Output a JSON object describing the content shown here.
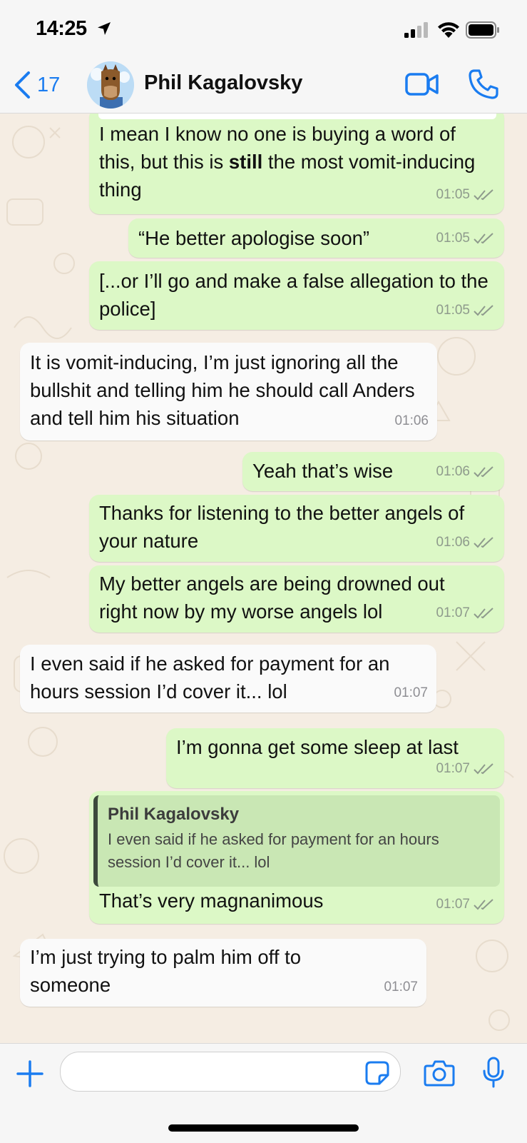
{
  "status_bar": {
    "time": "14:25"
  },
  "header": {
    "back_count": "17",
    "contact_name": "Phil Kagalovsky"
  },
  "messages": [
    {
      "dir": "out",
      "parts": [
        "I mean I know no one is buying a word of this, but this is ",
        "still",
        " the most vomit-inducing thing"
      ],
      "time": "01:05"
    },
    {
      "dir": "out",
      "text": "“He better apologise soon”",
      "time": "01:05"
    },
    {
      "dir": "out",
      "text": "[...or I’ll go and make a false allegation to the police]",
      "time": "01:05"
    },
    {
      "dir": "in",
      "text": "It is vomit-inducing, I’m just ignoring all the bullshit and telling him he should call Anders and tell him his situation",
      "time": "01:06"
    },
    {
      "dir": "out",
      "text": "Yeah that’s wise",
      "time": "01:06"
    },
    {
      "dir": "out",
      "text": "Thanks for listening to the better angels of your nature",
      "time": "01:06"
    },
    {
      "dir": "out",
      "text": "My better angels are being drowned out right now by my worse angels lol",
      "time": "01:07"
    },
    {
      "dir": "in",
      "text": "I even said if he asked for payment for an hours session I’d cover it... lol",
      "time": "01:07"
    },
    {
      "dir": "out",
      "text": "I’m gonna get some sleep at last",
      "time": "01:07"
    },
    {
      "dir": "out",
      "quote": {
        "name": "Phil Kagalovsky",
        "text": "I even said if he asked for payment for an hours session I’d cover it... lol"
      },
      "text": "That’s very magnanimous",
      "time": "01:07"
    },
    {
      "dir": "in",
      "text": "I’m just trying to palm him off to someone",
      "time": "01:07"
    }
  ],
  "colors": {
    "outgoing": "#dcf8c6",
    "incoming": "#fafafa",
    "accent": "#1a7cf0",
    "background": "#f5ede3"
  }
}
